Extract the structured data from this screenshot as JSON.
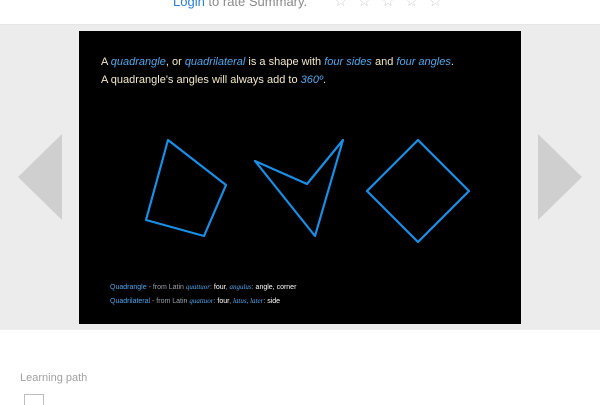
{
  "header": {
    "login_link": "Login",
    "login_suffix": " to rate Summary.",
    "stars": "☆ ☆ ☆ ☆ ☆"
  },
  "slide": {
    "line1": {
      "a": "A ",
      "quadrangle": "quadrangle",
      "or": ", or ",
      "quadrilateral": "quadrilateral",
      "is_shape": " is a shape with ",
      "four_sides": "four sides",
      "and": " and ",
      "four_angles": "four angles",
      "period": "."
    },
    "line2": {
      "text": "A quadrangle's angles will always add to ",
      "deg": "360º",
      "period": "."
    },
    "etymology": [
      {
        "term": "Quadrangle",
        "from": " - from Latin ",
        "latin1": "quattuor",
        "sep1": ": ",
        "en1": "four",
        "comma": ", ",
        "latin2": "angulus",
        "sep2": ": ",
        "en2": "angle, corner"
      },
      {
        "term": "Quadrilateral",
        "from": " - from Latin ",
        "latin1": "quattuor",
        "sep1": ": ",
        "en1": "four",
        "comma": ", ",
        "latin2": "latus, later",
        "sep2": ": ",
        "en2": "side"
      }
    ]
  },
  "footer": {
    "learning_path": "Learning path"
  },
  "colors": {
    "shape_stroke": "#1a8fe6",
    "highlight": "#54a8ec",
    "text": "#f4e9c8"
  }
}
